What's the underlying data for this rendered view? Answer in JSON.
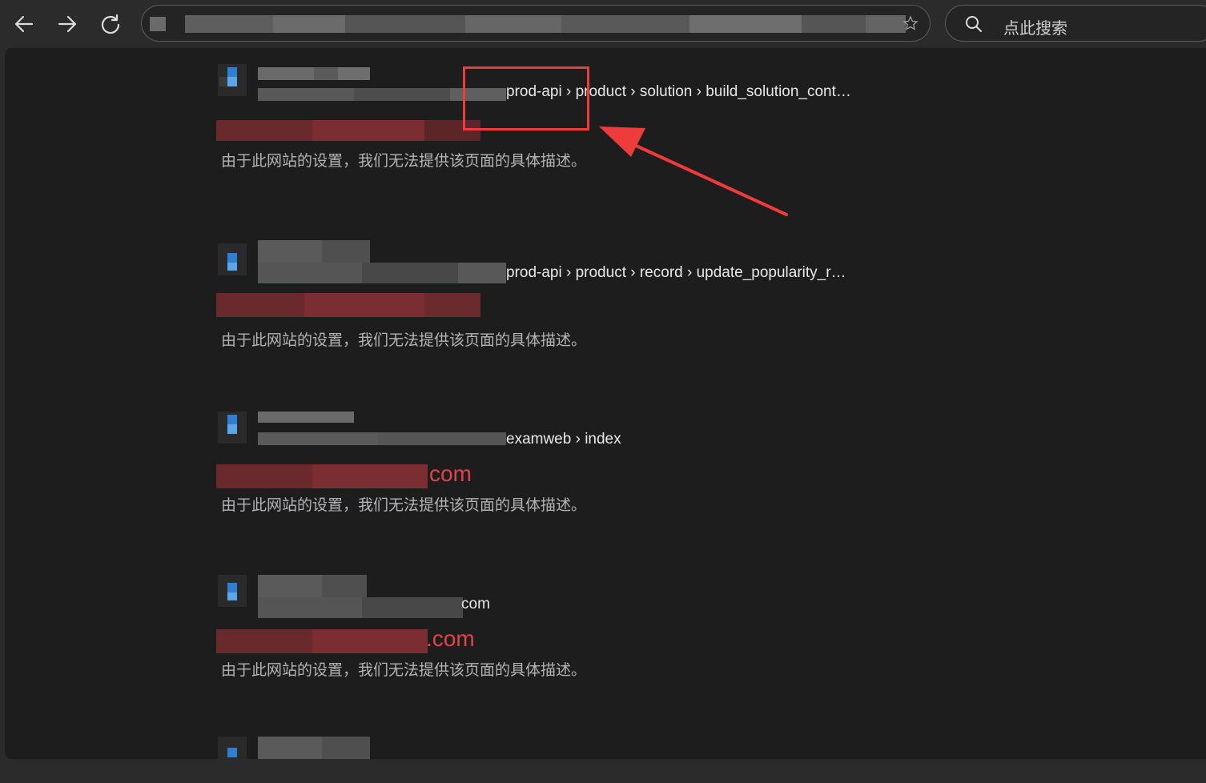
{
  "browser": {
    "search_placeholder": "点此搜索"
  },
  "results": [
    {
      "breadcrumb": "prod-api › product › solution › build_solution_cont…",
      "title": "",
      "description": "由于此网站的设置，我们无法提供该页面的具体描述。"
    },
    {
      "breadcrumb": "prod-api › product › record › update_popularity_r…",
      "title": "",
      "description": "由于此网站的设置，我们无法提供该页面的具体描述。"
    },
    {
      "breadcrumb": "examweb › index",
      "title": "com",
      "description": "由于此网站的设置，我们无法提供该页面的具体描述。"
    },
    {
      "breadcrumb": "com",
      "title": ".com",
      "description": "由于此网站的设置，我们无法提供该页面的具体描述。"
    }
  ],
  "colors": {
    "page_bg": "#1d1d1d",
    "chrome_bg": "#2b2b2b",
    "title_red": "#e0434a",
    "annotation_red": "#ef3b3b",
    "favicon_blue": "#2f7fd1"
  },
  "icons": [
    "back-arrow-icon",
    "forward-arrow-icon",
    "reload-icon",
    "star-icon",
    "search-icon",
    "site-favicon-icon"
  ]
}
